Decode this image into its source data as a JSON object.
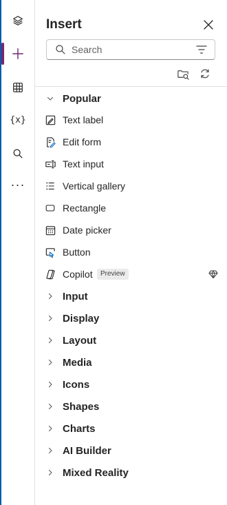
{
  "panel": {
    "title": "Insert",
    "search_placeholder": "Search"
  },
  "rail": [
    {
      "name": "tree-view",
      "icon": "layers-icon"
    },
    {
      "name": "insert",
      "icon": "plus-icon",
      "active": true
    },
    {
      "name": "data",
      "icon": "table-icon"
    },
    {
      "name": "variables",
      "icon": "variables-icon",
      "glyph": "{x}"
    },
    {
      "name": "search",
      "icon": "search-icon"
    },
    {
      "name": "more",
      "icon": "more-icon",
      "glyph": "···"
    }
  ],
  "popular": {
    "label": "Popular",
    "items": [
      {
        "label": "Text label",
        "icon": "text-label-icon"
      },
      {
        "label": "Edit form",
        "icon": "edit-form-icon"
      },
      {
        "label": "Text input",
        "icon": "text-input-icon"
      },
      {
        "label": "Vertical gallery",
        "icon": "vertical-gallery-icon"
      },
      {
        "label": "Rectangle",
        "icon": "rectangle-icon"
      },
      {
        "label": "Date picker",
        "icon": "date-picker-icon"
      },
      {
        "label": "Button",
        "icon": "button-icon"
      },
      {
        "label": "Copilot",
        "icon": "copilot-icon",
        "badge": "Preview",
        "premium": true
      }
    ]
  },
  "categories": [
    {
      "label": "Input"
    },
    {
      "label": "Display"
    },
    {
      "label": "Layout"
    },
    {
      "label": "Media"
    },
    {
      "label": "Icons"
    },
    {
      "label": "Shapes"
    },
    {
      "label": "Charts"
    },
    {
      "label": "AI Builder"
    },
    {
      "label": "Mixed Reality"
    }
  ],
  "colors": {
    "accent": "#742774",
    "edge": "#0b5cab",
    "text": "#242424"
  }
}
